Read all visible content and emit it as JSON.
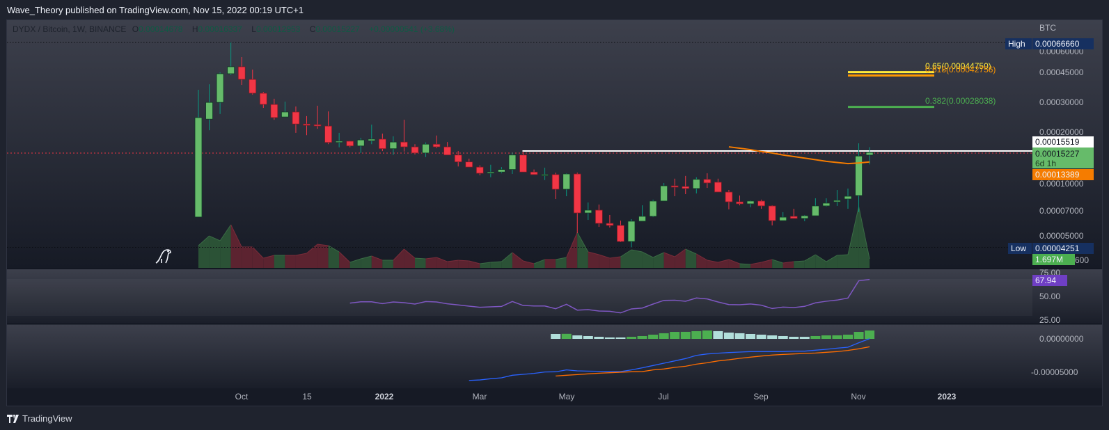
{
  "publish_line": "Wave_Theory published on TradingView.com, Nov 15, 2022 00:19 UTC+1",
  "legend": {
    "symbol": "DYDX / Bitcoin, 1W, BINANCE",
    "o_label": "O",
    "o": "0.00014678",
    "h_label": "H",
    "h": "0.00016337",
    "l_label": "L",
    "l": "0.00012953",
    "c_label": "C",
    "c": "0.00015227",
    "change": "+0.00000541 (+3.68%)"
  },
  "price_axis": {
    "currency": "BTC",
    "ticks": [
      "0.00060000",
      "0.00045000",
      "0.00030000",
      "0.00020000",
      "0.00010000",
      "0.00007000",
      "0.00005000",
      "600"
    ],
    "high_label": "High",
    "high_value": "0.00066660",
    "low_label": "Low",
    "low_value": "0.00004251",
    "hline_value": "0.00015519",
    "last_price": "0.00015227",
    "countdown": "6d 1h",
    "ma_value": "0.00013389",
    "volume_value": "1.697M"
  },
  "rsi_axis": {
    "ticks": [
      "75.00",
      "50.00",
      "25.00"
    ],
    "value": "67.94"
  },
  "macd_axis": {
    "ticks": [
      "0.00000000",
      "-0.00005000"
    ]
  },
  "time_axis": [
    "Oct",
    "15",
    "2022",
    "Mar",
    "May",
    "Jul",
    "Sep",
    "Nov",
    "2023"
  ],
  "fib_levels": [
    {
      "label": "0.65(0.00044750)",
      "price": 0.0004475,
      "color": "#ffeb3b"
    },
    {
      "label": "0.618(0.00042756)",
      "price": 0.00042756,
      "color": "#ff9800"
    },
    {
      "label": "0.382(0.00028038)",
      "price": 0.00028038,
      "color": "#4caf50"
    }
  ],
  "footer": {
    "brand": "TradingView"
  },
  "colors": {
    "up": "#66bb6a",
    "down": "#f23645",
    "up_wick": "#089981",
    "down_wick": "#f23645",
    "ma": "#f57c00",
    "rsi": "#7e57c2",
    "macd": "#2962ff",
    "signal": "#ff6d00",
    "hist_up": "#4caf50",
    "hist_down": "#b2dfdb"
  },
  "chart_data": {
    "type": "candlestick",
    "title": "DYDX / Bitcoin, 1W, BINANCE",
    "interval": "1W",
    "scale": "log",
    "ylabel": "BTC",
    "ylim": [
      3.6e-05,
      0.00068
    ],
    "x_tick_labels": [
      "Oct",
      "15",
      "2022",
      "Mar",
      "May",
      "Jul",
      "Sep",
      "Nov",
      "2023"
    ],
    "ohlc": [
      [
        6.39e-05,
        0.000353,
        6.39e-05,
        0.000243
      ],
      [
        0.000238,
        0.00038,
        0.000205,
        0.000298
      ],
      [
        0.000298,
        0.000446,
        0.000255,
        0.000438
      ],
      [
        0.000438,
        0.0006666,
        0.00043,
        0.000481
      ],
      [
        0.000481,
        0.000548,
        0.000377,
        0.000406
      ],
      [
        0.000406,
        0.000463,
        0.000331,
        0.000337
      ],
      [
        0.000337,
        0.000343,
        0.000277,
        0.00029
      ],
      [
        0.00029,
        0.000313,
        0.000236,
        0.000243
      ],
      [
        0.000245,
        0.000301,
        0.000245,
        0.000262
      ],
      [
        0.000262,
        0.000282,
        0.000198,
        0.000223
      ],
      [
        0.000223,
        0.000248,
        0.000192,
        0.000219
      ],
      [
        0.000221,
        0.000285,
        0.000209,
        0.000217
      ],
      [
        0.000217,
        0.000264,
        0.00017,
        0.000174
      ],
      [
        0.000174,
        0.000198,
        0.000163,
        0.000177
      ],
      [
        0.000177,
        0.000178,
        0.000163,
        0.000166
      ],
      [
        0.000166,
        0.000185,
        0.000151,
        0.00018
      ],
      [
        0.000178,
        0.000221,
        0.00017,
        0.000182
      ],
      [
        0.000182,
        0.000196,
        0.000155,
        0.00016
      ],
      [
        0.00016,
        0.000189,
        0.000147,
        0.000175
      ],
      [
        0.000175,
        0.000236,
        0.000154,
        0.000164
      ],
      [
        0.000164,
        0.00017,
        0.000148,
        0.000151
      ],
      [
        0.000151,
        0.000174,
        0.000143,
        0.00017
      ],
      [
        0.00017,
        0.000191,
        0.000161,
        0.000164
      ],
      [
        0.000164,
        0.000175,
        0.000147,
        0.000147
      ],
      [
        0.000147,
        0.000155,
        0.000126,
        0.000134
      ],
      [
        0.000134,
        0.00014,
        0.000125,
        0.000125
      ],
      [
        0.000125,
        0.000128,
        0.000112,
        0.000115
      ],
      [
        0.000115,
        0.000129,
        0.000109,
        0.000117
      ],
      [
        0.000117,
        0.000125,
        0.000115,
        0.000121
      ],
      [
        0.000121,
        0.000152,
        0.000114,
        0.000147
      ],
      [
        0.000147,
        0.000154,
        0.000117,
        0.000117
      ],
      [
        0.000117,
        0.000121,
        0.000113,
        0.000113
      ],
      [
        0.000112,
        0.000124,
        0.000105,
        0.000113
      ],
      [
        0.000113,
        0.000116,
        8.14e-05,
        9.28e-05
      ],
      [
        9.28e-05,
        0.000115,
        8.45e-05,
        0.000114
      ],
      [
        0.000114,
        0.000116,
        5.15e-05,
        6.75e-05
      ],
      [
        6.75e-05,
        7.77e-05,
        6.15e-05,
        7.01e-05
      ],
      [
        7.01e-05,
        7.56e-05,
        5.6e-05,
        5.87e-05
      ],
      [
        5.87e-05,
        6.57e-05,
        5.55e-05,
        5.71e-05
      ],
      [
        5.71e-05,
        6.09e-05,
        4.56e-05,
        4.6e-05
      ],
      [
        4.6e-05,
        6.21e-05,
        4.251e-05,
        6.04e-05
      ],
      [
        6.04e-05,
        7.48e-05,
        6.04e-05,
        6.45e-05
      ],
      [
        6.45e-05,
        8.07e-05,
        6.38e-05,
        7.92e-05
      ],
      [
        7.92e-05,
        0.000101,
        7.92e-05,
        9.72e-05
      ],
      [
        9.72e-05,
        0.000107,
        8.45e-05,
        9.54e-05
      ],
      [
        9.63e-05,
        0.000111,
        8.69e-05,
        9.37e-05
      ],
      [
        9.37e-05,
        0.000109,
        8.77e-05,
        0.000106
      ],
      [
        0.000106,
        0.000115,
        9.45e-05,
        0.000101
      ],
      [
        0.000102,
        0.000107,
        8.94e-05,
        8.94e-05
      ],
      [
        8.94e-05,
        9.19e-05,
        7.08e-05,
        7.84e-05
      ],
      [
        7.84e-05,
        8.53e-05,
        7.48e-05,
        7.63e-05
      ],
      [
        7.63e-05,
        7.99e-05,
        7.28e-05,
        7.92e-05
      ],
      [
        7.92e-05,
        8.07e-05,
        7.14e-05,
        7.42e-05
      ],
      [
        7.42e-05,
        7.48e-05,
        5.71e-05,
        6.09e-05
      ],
      [
        6.09e-05,
        6.82e-05,
        6.09e-05,
        6.38e-05
      ],
      [
        6.45e-05,
        7.14e-05,
        6.27e-05,
        6.27e-05
      ],
      [
        6.27e-05,
        6.57e-05,
        6.04e-05,
        6.5e-05
      ],
      [
        6.5e-05,
        8.22e-05,
        6.5e-05,
        7.42e-05
      ],
      [
        7.42e-05,
        8.22e-05,
        7.35e-05,
        7.7e-05
      ],
      [
        7.84e-05,
        9.19e-05,
        7.42e-05,
        7.99e-05
      ],
      [
        8.14e-05,
        9.37e-05,
        7.14e-05,
        8.45e-05
      ],
      [
        8.53e-05,
        0.000172,
        6.82e-05,
        0.000145
      ],
      [
        0.00014678,
        0.00016337,
        0.00012953,
        0.00015227
      ]
    ],
    "volume_millions": [
      4.18,
      6.0,
      5.09,
      8.09,
      3.92,
      3.92,
      1.83,
      2.35,
      2.35,
      2.35,
      2.74,
      4.44,
      4.18,
      3.0,
      1.04,
      1.7,
      2.22,
      1.44,
      1.44,
      3.52,
      1.83,
      1.7,
      1.96,
      1.17,
      1.44,
      1.31,
      0.78,
      1.04,
      1.17,
      2.87,
      1.31,
      0.78,
      1.57,
      1.57,
      1.96,
      6.66,
      3.0,
      2.48,
      1.83,
      2.09,
      3.39,
      3.0,
      1.96,
      2.87,
      2.09,
      3.52,
      2.61,
      1.44,
      1.04,
      1.57,
      0.78,
      0.65,
      1.04,
      1.57,
      0.91,
      1.17,
      1.31,
      2.48,
      1.17,
      2.35,
      2.48,
      11.48,
      1.697
    ],
    "ma_start_index": 49,
    "ma": [
      0.000164,
      0.000161,
      0.000158,
      0.000154,
      0.000151,
      0.000147,
      0.000144,
      0.000141,
      0.000138,
      0.000135,
      0.000133,
      0.000131,
      0.000132,
      0.00013389
    ],
    "hline_start_index": 30,
    "hline_price": 0.00015519,
    "high": 0.0006666,
    "low": 4.251e-05,
    "rsi_start_index": 14,
    "rsi": [
      42.9,
      44.3,
      44.3,
      42.4,
      44.1,
      43.4,
      41.9,
      44.6,
      44.1,
      42.2,
      41.0,
      39.7,
      38.5,
      39.0,
      39.4,
      44.6,
      40.4,
      39.9,
      39.9,
      37.0,
      41.7,
      35.5,
      36.0,
      34.6,
      34.3,
      32.6,
      36.8,
      37.7,
      41.9,
      45.8,
      46.0,
      44.9,
      48.3,
      47.3,
      44.1,
      41.4,
      41.2,
      42.0,
      40.7,
      37.2,
      38.7,
      38.2,
      39.5,
      43.2,
      44.9,
      46.1,
      48.3,
      66.5,
      67.94
    ],
    "rsi_band": [
      30,
      70
    ],
    "macd_start_index": 25,
    "macd_e6": [
      -62.2,
      -61.5,
      -59.7,
      -58.3,
      -54.5,
      -53.1,
      -51.7,
      -49.6,
      -49.3,
      -46.5,
      -47.9,
      -48.3,
      -48.6,
      -49.0,
      -49.0,
      -46.5,
      -43.4,
      -39.9,
      -36.5,
      -33.0,
      -29.5,
      -24.7,
      -22.6,
      -21.5,
      -20.5,
      -19.8,
      -19.1,
      -19.1,
      -19.1,
      -19.1,
      -18.4,
      -18.4,
      -17.0,
      -15.6,
      -13.9,
      -12.5,
      -5.9,
      0.3
    ],
    "signal_start_index": 33,
    "signal_e6": [
      -55.6,
      -54.5,
      -53.5,
      -52.4,
      -51.4,
      -50.7,
      -50.0,
      -49.3,
      -49.0,
      -46.5,
      -45.1,
      -42.7,
      -41.0,
      -37.9,
      -35.8,
      -33.0,
      -31.3,
      -29.2,
      -27.4,
      -25.7,
      -24.3,
      -23.3,
      -22.6,
      -21.9,
      -21.2,
      -20.1,
      -19.1,
      -17.3,
      -14.9,
      -11.8
    ],
    "histogram_e6": [
      7.3,
      7.5,
      5.2,
      4.2,
      3.1,
      2.1,
      2.09,
      3.1,
      4.2,
      6.3,
      8.4,
      10.4,
      10.5,
      11.5,
      12.5,
      11.5,
      9.4,
      8.4,
      7.3,
      6.3,
      5.2,
      4.2,
      3.1,
      3.05,
      4.2,
      5.2,
      5.3,
      6.3,
      10.4,
      12.5
    ]
  }
}
